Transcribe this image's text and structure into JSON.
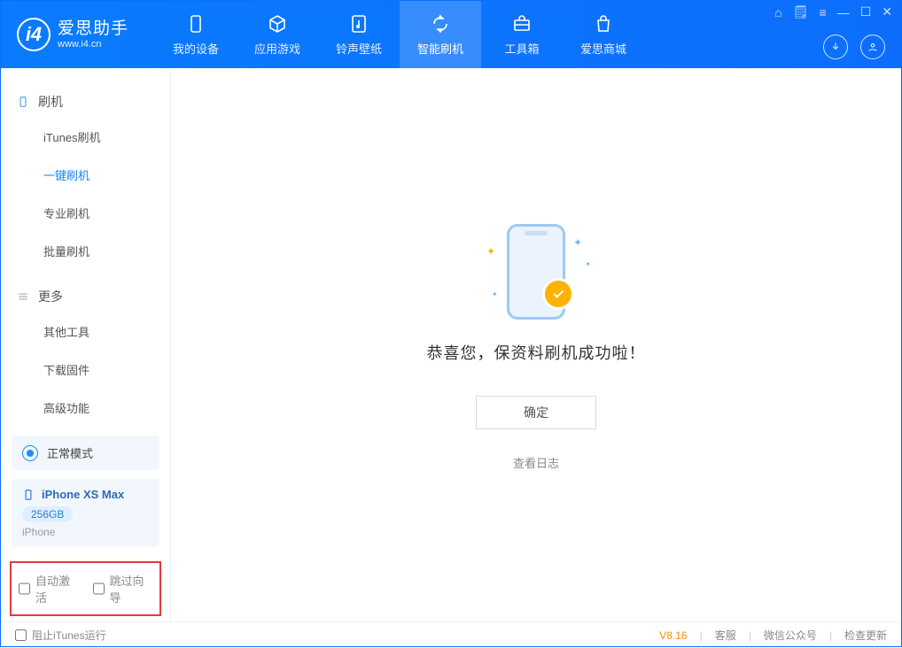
{
  "app": {
    "name": "爱思助手",
    "domain": "www.i4.cn"
  },
  "titlebar": {
    "icons": [
      "shirt-icon",
      "note-icon",
      "list-icon",
      "minimize-icon",
      "maximize-icon",
      "close-icon"
    ]
  },
  "nav": {
    "tabs": [
      {
        "label": "我的设备",
        "icon": "device-icon"
      },
      {
        "label": "应用游戏",
        "icon": "cube-icon"
      },
      {
        "label": "铃声壁纸",
        "icon": "music-icon"
      },
      {
        "label": "智能刷机",
        "icon": "refresh-icon",
        "active": true
      },
      {
        "label": "工具箱",
        "icon": "toolbox-icon"
      },
      {
        "label": "爱思商城",
        "icon": "bag-icon"
      }
    ]
  },
  "sidebar": {
    "groups": [
      {
        "title": "刷机",
        "icon": "phone-icon",
        "items": [
          "iTunes刷机",
          "一键刷机",
          "专业刷机",
          "批量刷机"
        ],
        "activeIndex": 1
      },
      {
        "title": "更多",
        "icon": "menu-icon",
        "items": [
          "其他工具",
          "下载固件",
          "高级功能"
        ]
      }
    ],
    "mode": {
      "label": "正常模式"
    },
    "device": {
      "name": "iPhone XS Max",
      "capacity": "256GB",
      "type": "iPhone"
    },
    "options": {
      "auto_activate": "自动激活",
      "skip_guide": "跳过向导"
    }
  },
  "main": {
    "success_msg": "恭喜您，保资料刷机成功啦！",
    "ok_label": "确定",
    "log_link": "查看日志"
  },
  "footer": {
    "block_itunes": "阻止iTunes运行",
    "version": "V8.16",
    "links": [
      "客服",
      "微信公众号",
      "检查更新"
    ]
  }
}
